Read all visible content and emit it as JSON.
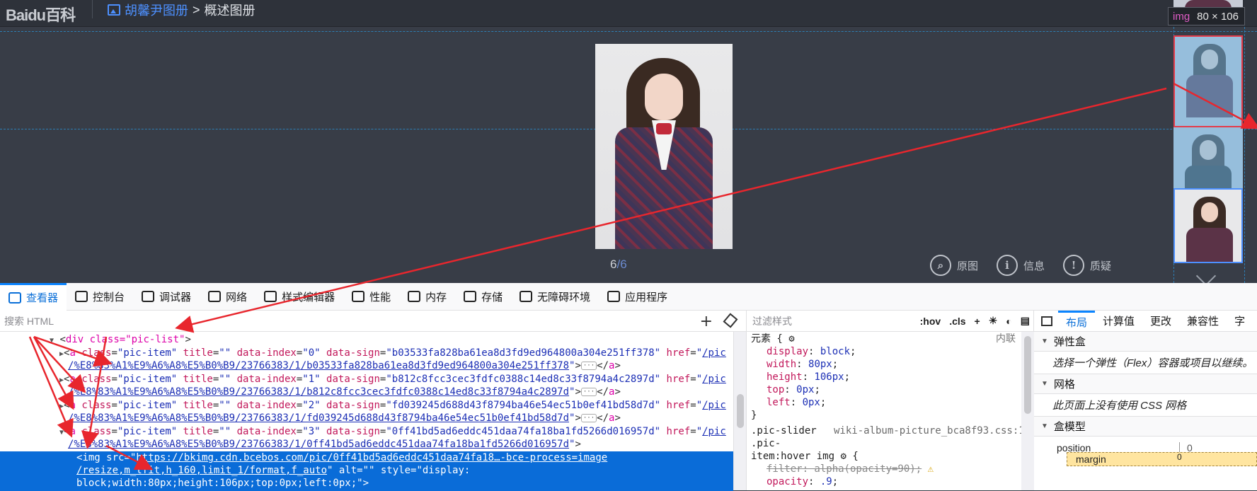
{
  "page": {
    "logo": "Baidu百科",
    "breadcrumb_link": "胡馨尹图册",
    "breadcrumb_sep": ">",
    "breadcrumb_current": "概述图册",
    "counter_current": "6",
    "counter_total": "/6",
    "tools": [
      {
        "label": "原图",
        "icon": "magnifier-icon"
      },
      {
        "label": "信息",
        "icon": "info-icon"
      },
      {
        "label": "质疑",
        "icon": "exclamation-icon"
      }
    ],
    "highlight_tooltip": {
      "tag": "img",
      "dims": "80 × 106"
    }
  },
  "devtools": {
    "tabs": [
      {
        "label": "查看器",
        "icon": "inspector-icon",
        "active": true
      },
      {
        "label": "控制台",
        "icon": "console-icon"
      },
      {
        "label": "调试器",
        "icon": "debugger-icon"
      },
      {
        "label": "网络",
        "icon": "network-icon"
      },
      {
        "label": "样式编辑器",
        "icon": "braces-icon"
      },
      {
        "label": "性能",
        "icon": "gauge-icon"
      },
      {
        "label": "内存",
        "icon": "memory-icon"
      },
      {
        "label": "存储",
        "icon": "storage-icon"
      },
      {
        "label": "无障碍环境",
        "icon": "accessibility-icon"
      },
      {
        "label": "应用程序",
        "icon": "grid-icon"
      }
    ],
    "search_placeholder": "搜索 HTML",
    "markup": {
      "root": "div class=\"pic-list\"",
      "items": [
        {
          "index": "0",
          "sign": "b03533fa828ba61ea8d3fd9ed964800a304e251ff378",
          "href1": "/pic",
          "href2": "/%E8%83%A1%E9%A6%A8%E5%B0%B9/23766383/1/b03533fa828ba61ea8d3fd9ed964800a304e251ff378"
        },
        {
          "index": "1",
          "sign": "b812c8fcc3cec3fdfc0388c14ed8c33f8794a4c2897d",
          "href1": "/pic",
          "href2": "/%E8%83%A1%E9%A6%A8%E5%B0%B9/23766383/1/b812c8fcc3cec3fdfc0388c14ed8c33f8794a4c2897d"
        },
        {
          "index": "2",
          "sign": "fd039245d688d43f8794ba46e54ec51b0ef41bd58d7d",
          "href1": "/pic",
          "href2": "/%E8%83%A1%E9%A6%A8%E5%B0%B9/23766383/1/fd039245d688d43f8794ba46e54ec51b0ef41bd58d7d"
        },
        {
          "index": "3",
          "sign": "0ff41bd5ad6eddc451daa74fa18ba1fd5266d016957d",
          "href1": "/pic",
          "href2": "/%E8%83%A1%E9%A6%A8%E5%B0%B9/23766383/1/0ff41bd5ad6eddc451daa74fa18ba1fd5266d016957d"
        }
      ],
      "img_src": "https://bkimg.cdn.bcebos.com/pic/0ff41bd5ad6eddc451daa74fa18…-bce-process=image",
      "img_src2": "/resize,m_lfit,h_160,limit_1/format,f_auto",
      "img_alt_style": "\" alt=\"\" style=\"display:",
      "img_style2": "block;width:80px;height:106px;top:0px;left:0px;\">"
    },
    "rules": {
      "filter_placeholder": "过滤样式",
      "hov": ":hov",
      "cls": ".cls",
      "element_label": "元素 {",
      "inline_label": "内联",
      "decls": [
        {
          "prop": "display",
          "value": "block"
        },
        {
          "prop": "width",
          "value": "80px"
        },
        {
          "prop": "height",
          "value": "106px"
        },
        {
          "prop": "top",
          "value": "0px"
        },
        {
          "prop": "left",
          "value": "0px"
        }
      ],
      "close": "}",
      "rule2_selector1": ".pic-slider",
      "rule2_source": "wiki-album-picture_bca8f93.css:1",
      "rule2_selector2": ".pic-",
      "rule2_selector3": "item:hover img",
      "rule2_filter": "filter: alpha(opacity=90);",
      "rule2_opacity_prop": "opacity",
      "rule2_opacity_val": ".9"
    },
    "layout": {
      "tabs": [
        "布局",
        "计算值",
        "更改",
        "兼容性",
        "字"
      ],
      "flex_title": "弹性盒",
      "flex_body": "选择一个弹性（Flex）容器或项目以继续。",
      "grid_title": "网格",
      "grid_body": "此页面上没有使用 CSS 网格",
      "box_title": "盒模型",
      "position_label": "position",
      "position_value": "0",
      "margin_label": "margin",
      "margin_value": "0"
    }
  }
}
